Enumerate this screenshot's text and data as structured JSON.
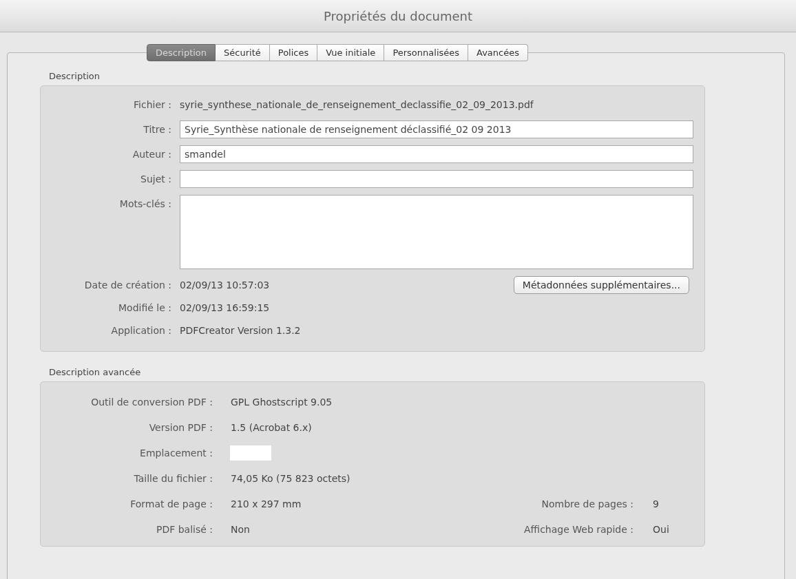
{
  "window": {
    "title": "Propriétés du document"
  },
  "tabs": [
    {
      "label": "Description",
      "selected": true
    },
    {
      "label": "Sécurité",
      "selected": false
    },
    {
      "label": "Polices",
      "selected": false
    },
    {
      "label": "Vue initiale",
      "selected": false
    },
    {
      "label": "Personnalisées",
      "selected": false
    },
    {
      "label": "Avancées",
      "selected": false
    }
  ],
  "description": {
    "heading": "Description",
    "fields": [
      {
        "kind": "text",
        "label": "Fichier :",
        "value": "syrie_synthese_nationale_de_renseignement_declassifie_02_09_2013.pdf"
      },
      {
        "kind": "field",
        "label": "Titre :",
        "value": "Syrie_Synthèse nationale de renseignement déclassifié_02 09 2013"
      },
      {
        "kind": "field",
        "label": "Auteur :",
        "value": "smandel"
      },
      {
        "kind": "field",
        "label": "Sujet :"
      },
      {
        "kind": "area",
        "label": "Mots-clés :"
      }
    ],
    "dates": [
      {
        "label": "Date de création :",
        "value": "02/09/13 10:57:03"
      },
      {
        "label": "Modifié le :",
        "value": "02/09/13 16:59:15"
      },
      {
        "label": "Application :",
        "value": "PDFCreator Version 1.3.2"
      }
    ],
    "button": "Métadonnées supplémentaires..."
  },
  "advanced": {
    "heading": "Description avancée",
    "rows": [
      [
        {
          "kind": "text",
          "label": "Outil de conversion PDF :",
          "value": "GPL Ghostscript 9.05"
        }
      ],
      [
        {
          "kind": "text",
          "label": "Version PDF :",
          "value": "1.5 (Acrobat 6.x)"
        }
      ],
      [
        {
          "kind": "field",
          "label": "Emplacement :"
        }
      ],
      [
        {
          "kind": "text",
          "label": "Taille du fichier :",
          "value": "74,05 Ko (75 823 octets)"
        }
      ],
      [
        {
          "kind": "text",
          "label": "Format de page :",
          "value": "210 x 297 mm"
        },
        {
          "kind": "text",
          "label": "Nombre de pages :",
          "value": "9"
        }
      ],
      [
        {
          "kind": "text",
          "label": "PDF balisé :",
          "value": "Non"
        },
        {
          "kind": "text",
          "label": "Affichage Web rapide :",
          "value": "Oui"
        }
      ]
    ]
  }
}
